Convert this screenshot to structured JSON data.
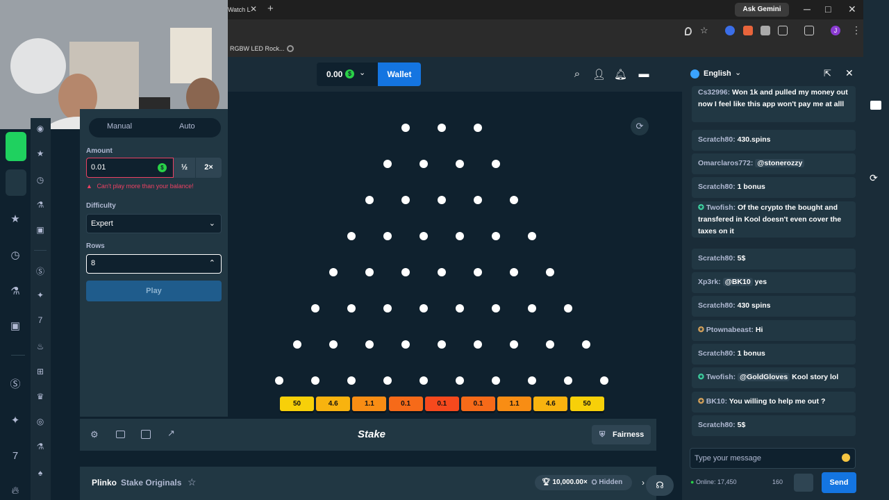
{
  "browser": {
    "tab_title": "Watch L",
    "tab_close": "✕",
    "new_tab": "+",
    "ask_gemini": "Ask Gemini",
    "minimize": "─",
    "maximize": "□",
    "close": "✕",
    "profile_initial": "J",
    "bookmark": "RGBW LED Rock..."
  },
  "header": {
    "balance": "0.00",
    "coin_symbol": "$",
    "wallet_label": "Wallet"
  },
  "controls": {
    "tab_manual": "Manual",
    "tab_auto": "Auto",
    "amount_label": "Amount",
    "amount_value": "0.01",
    "half_label": "½",
    "double_label": "2×",
    "warning": "Can't play more than your balance!",
    "difficulty_label": "Difficulty",
    "difficulty_value": "Expert",
    "rows_label": "Rows",
    "rows_value": "8",
    "play_label": "Play"
  },
  "board": {
    "rows": 8,
    "multipliers": [
      "50",
      "4.6",
      "1.1",
      "0.1",
      "0.1",
      "0.1",
      "1.1",
      "4.6",
      "50"
    ],
    "slot_colors": [
      "#f7d009",
      "#f8b30f",
      "#f88d14",
      "#f66a19",
      "#f6491d",
      "#f66a19",
      "#f88d14",
      "#f8b30f",
      "#f7d009"
    ]
  },
  "footer": {
    "logo": "Stake",
    "fairness_label": "Fairness"
  },
  "game_info": {
    "title": "Plinko",
    "subtitle": "Stake Originals",
    "record": "10,000.00×",
    "record_user": "Hidden"
  },
  "chat": {
    "language": "English",
    "messages": [
      {
        "user": "Cs32996:",
        "text": "Won 1k and pulled my money out now I feel like this app won't pay me at alll"
      },
      {
        "user": "Scratch80:",
        "text": "430.spins"
      },
      {
        "user": "Omarclaros772:",
        "mention": "@stonerozzy",
        "text": ""
      },
      {
        "user": "Scratch80:",
        "text": "1 bonus"
      },
      {
        "user": "Twofish:",
        "text": "Of the crypto the bought and transfered in Kool doesn't even cover the taxes on it"
      },
      {
        "user": "Scratch80:",
        "text": "5$"
      },
      {
        "user": "Xp3rk:",
        "mention": "@BK10",
        "text": "yes"
      },
      {
        "user": "Scratch80:",
        "text": "430 spins"
      },
      {
        "user": "Ptownabeast:",
        "text": "Hi"
      },
      {
        "user": "Scratch80:",
        "text": "1 bonus"
      },
      {
        "user": "Twofish:",
        "mention": "@GoldGloves",
        "text": "Kool story lol"
      },
      {
        "user": "BK10:",
        "text": "You willing to help me out ?"
      },
      {
        "user": "Scratch80:",
        "text": "5$"
      }
    ],
    "input_placeholder": "Type your message",
    "online": "Online: 17,450",
    "char_count": "160",
    "send_label": "Send"
  },
  "colors": {
    "bg_dark": "#0f212e",
    "bg_panel": "#213743",
    "accent_blue": "#1475e1",
    "success_green": "#29d147",
    "error_red": "#ed4163"
  }
}
